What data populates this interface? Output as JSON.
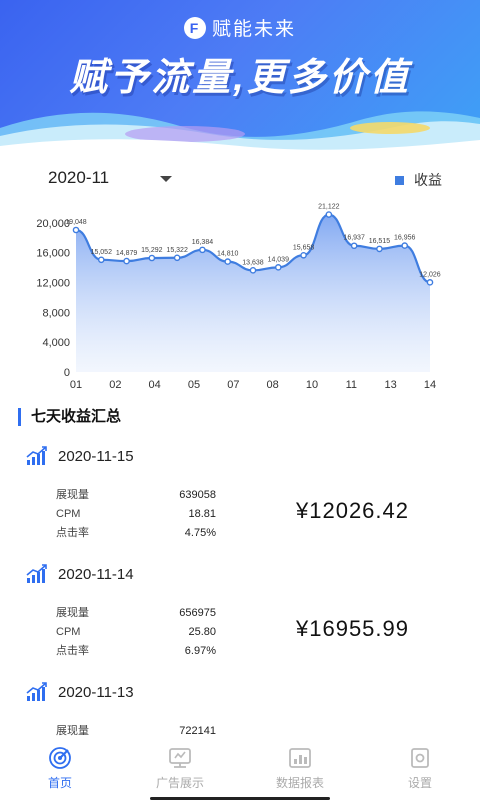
{
  "banner": {
    "brand": "赋能未来",
    "slogan": "赋予流量,更多价值"
  },
  "month_select": {
    "value": "2020-11"
  },
  "legend": {
    "label": "收益",
    "color": "#3f7de0"
  },
  "chart_data": {
    "type": "area",
    "x": [
      "01",
      "02",
      "03",
      "04",
      "05",
      "06",
      "07",
      "08",
      "09",
      "10",
      "11",
      "12",
      "13",
      "14"
    ],
    "x_tick_labels": [
      "01",
      "02",
      "04",
      "05",
      "07",
      "08",
      "10",
      "11",
      "13",
      "14"
    ],
    "values": [
      19048,
      15052,
      14879,
      15292,
      15322,
      16384,
      14810,
      13638,
      14039,
      15658,
      21122,
      16937,
      16515,
      16956,
      12026
    ],
    "value_labels": [
      "19,048",
      "15,052",
      "14,879",
      "15,292",
      "15,322",
      "16,384",
      "14,810",
      "13,638",
      "14,039",
      "15,658",
      "21,122",
      "16,937",
      "16,515",
      "16,956",
      "12,026"
    ],
    "y_ticks": [
      0,
      4000,
      8000,
      12000,
      16000,
      20000
    ],
    "y_tick_labels": [
      "0",
      "4,000",
      "8,000",
      "12,000",
      "16,000",
      "20,000"
    ],
    "ylim": [
      0,
      22000
    ],
    "series_name": "收益",
    "line_color": "#3f7de0",
    "grid": false
  },
  "section_title": "七天收益汇总",
  "records": [
    {
      "date": "2020-11-15",
      "impressions_label": "展现量",
      "impressions": "639058",
      "cpm_label": "CPM",
      "cpm": "18.81",
      "ctr_label": "点击率",
      "ctr": "4.75%",
      "amount": "¥12026.42"
    },
    {
      "date": "2020-11-14",
      "impressions_label": "展现量",
      "impressions": "656975",
      "cpm_label": "CPM",
      "cpm": "25.80",
      "ctr_label": "点击率",
      "ctr": "6.97%",
      "amount": "¥16955.99"
    },
    {
      "date": "2020-11-13",
      "impressions_label": "展现量",
      "impressions": "722141",
      "cpm_label": "CPM",
      "cpm": "",
      "ctr_label": "点击率",
      "ctr": "",
      "amount": ""
    }
  ],
  "nav": {
    "items": [
      {
        "label": "首页",
        "icon": "radar-icon",
        "active": true
      },
      {
        "label": "广告展示",
        "icon": "ad-display-icon",
        "active": false
      },
      {
        "label": "数据报表",
        "icon": "data-report-icon",
        "active": false
      },
      {
        "label": "设置",
        "icon": "settings-icon",
        "active": false
      }
    ],
    "active_color": "#2f6ef0"
  }
}
